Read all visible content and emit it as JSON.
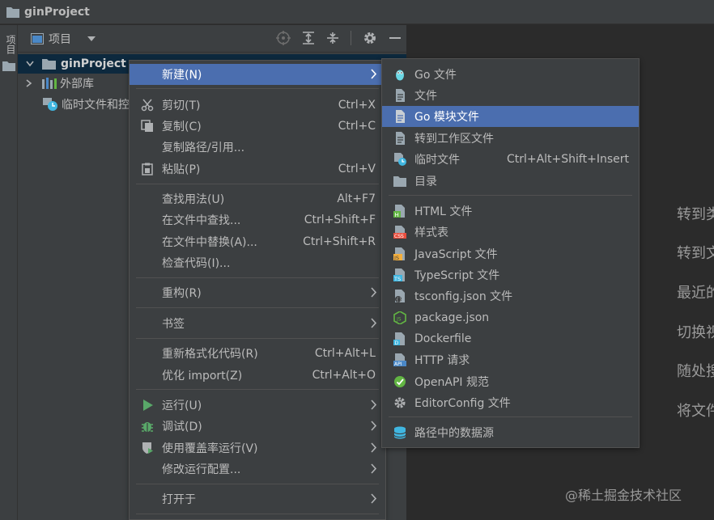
{
  "titlebar": {
    "title": "ginProject"
  },
  "left_tool_window": {
    "label": "项目"
  },
  "project_panel": {
    "view_label": "项目",
    "tree": [
      {
        "label": "ginProject"
      },
      {
        "label": "外部库"
      },
      {
        "label": "临时文件和控"
      }
    ]
  },
  "editor_hints": [
    "转到类",
    "转到文",
    "最近的",
    "切换视",
    "随处搜",
    "将文件"
  ],
  "watermark": "@稀土掘金技术社区",
  "context_menu": {
    "items": [
      {
        "label": "新建(N)",
        "shortcut": ""
      },
      {
        "label": "剪切(T)",
        "shortcut": "Ctrl+X"
      },
      {
        "label": "复制(C)",
        "shortcut": "Ctrl+C"
      },
      {
        "label": "复制路径/引用...",
        "shortcut": ""
      },
      {
        "label": "粘贴(P)",
        "shortcut": "Ctrl+V"
      },
      {
        "label": "查找用法(U)",
        "shortcut": "Alt+F7"
      },
      {
        "label": "在文件中查找...",
        "shortcut": "Ctrl+Shift+F"
      },
      {
        "label": "在文件中替换(A)...",
        "shortcut": "Ctrl+Shift+R"
      },
      {
        "label": "检查代码(I)...",
        "shortcut": ""
      },
      {
        "label": "重构(R)",
        "shortcut": ""
      },
      {
        "label": "书签",
        "shortcut": ""
      },
      {
        "label": "重新格式化代码(R)",
        "shortcut": "Ctrl+Alt+L"
      },
      {
        "label": "优化 import(Z)",
        "shortcut": "Ctrl+Alt+O"
      },
      {
        "label": "运行(U)",
        "shortcut": ""
      },
      {
        "label": "调试(D)",
        "shortcut": ""
      },
      {
        "label": "使用覆盖率运行(V)",
        "shortcut": ""
      },
      {
        "label": "修改运行配置...",
        "shortcut": ""
      },
      {
        "label": "打开于",
        "shortcut": ""
      }
    ]
  },
  "new_submenu": {
    "items": [
      {
        "label": "Go 文件",
        "shortcut": ""
      },
      {
        "label": "文件",
        "shortcut": ""
      },
      {
        "label": "Go 模块文件",
        "shortcut": ""
      },
      {
        "label": "转到工作区文件",
        "shortcut": ""
      },
      {
        "label": "临时文件",
        "shortcut": "Ctrl+Alt+Shift+Insert"
      },
      {
        "label": "目录",
        "shortcut": ""
      },
      {
        "label": "HTML 文件",
        "shortcut": ""
      },
      {
        "label": "样式表",
        "shortcut": ""
      },
      {
        "label": "JavaScript 文件",
        "shortcut": ""
      },
      {
        "label": "TypeScript 文件",
        "shortcut": ""
      },
      {
        "label": "tsconfig.json 文件",
        "shortcut": ""
      },
      {
        "label": "package.json",
        "shortcut": ""
      },
      {
        "label": "Dockerfile",
        "shortcut": ""
      },
      {
        "label": "HTTP 请求",
        "shortcut": ""
      },
      {
        "label": "OpenAPI 规范",
        "shortcut": ""
      },
      {
        "label": "EditorConfig 文件",
        "shortcut": ""
      },
      {
        "label": "路径中的数据源",
        "shortcut": ""
      }
    ]
  },
  "colors": {
    "highlight": "#4b6eaf",
    "background": "#3c3f41",
    "editor": "#2b2b2b",
    "selection": "#0d293e"
  }
}
